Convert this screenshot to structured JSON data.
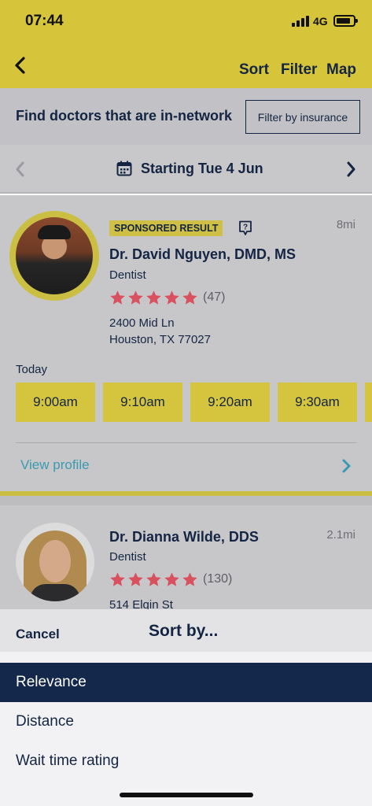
{
  "status": {
    "time": "07:44",
    "network": "4G"
  },
  "nav": {
    "sort": "Sort",
    "filter": "Filter",
    "map": "Map"
  },
  "insurance": {
    "prompt": "Find doctors that are in-network",
    "button": "Filter by insurance"
  },
  "date_bar": {
    "label": "Starting Tue 4 Jun"
  },
  "doctors": [
    {
      "badge": "SPONSORED RESULT",
      "distance": "8mi",
      "name": "Dr. David Nguyen, DMD, MS",
      "specialty": "Dentist",
      "rating": 5,
      "reviews": "(47)",
      "address_line1": "2400 Mid Ln",
      "address_line2": "Houston, TX 77027",
      "availability_day": "Today",
      "slots": [
        "9:00am",
        "9:10am",
        "9:20am",
        "9:30am"
      ],
      "view_profile": "View profile"
    },
    {
      "distance": "2.1mi",
      "name": "Dr. Dianna Wilde, DDS",
      "specialty": "Dentist",
      "rating": 5,
      "reviews": "(130)",
      "address_line1": "514 Elgin St"
    }
  ],
  "sort_sheet": {
    "cancel": "Cancel",
    "title": "Sort by...",
    "options": [
      "Relevance",
      "Distance",
      "Wait time rating"
    ],
    "selected": "Relevance"
  },
  "colors": {
    "brand_yellow": "#d6c53a",
    "navy": "#14284b",
    "star_red": "#d9505f",
    "link_blue": "#3a9ab0"
  }
}
